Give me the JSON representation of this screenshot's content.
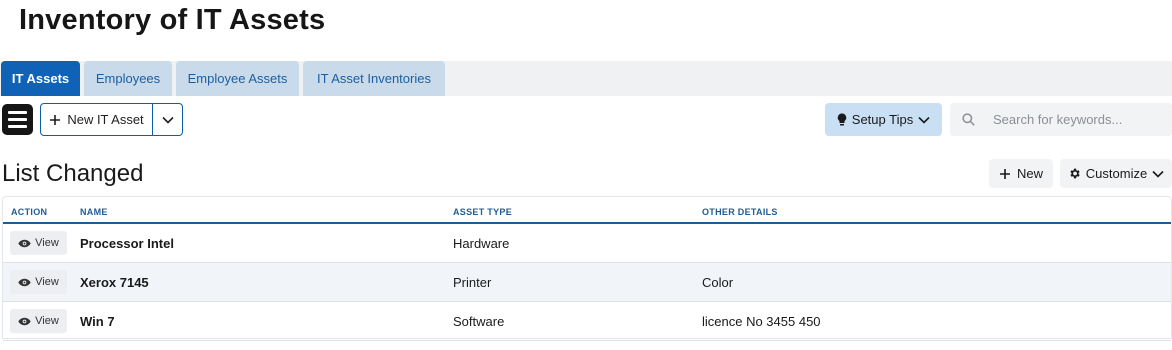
{
  "page": {
    "title": "Inventory of IT Assets"
  },
  "tabs": [
    {
      "label": "IT Assets",
      "active": true
    },
    {
      "label": "Employees",
      "active": false
    },
    {
      "label": "Employee Assets",
      "active": false
    },
    {
      "label": "IT Asset Inventories",
      "active": false
    }
  ],
  "toolbar": {
    "new_asset_label": "New IT Asset",
    "setup_tips_label": "Setup Tips",
    "search_placeholder": "Search for keywords..."
  },
  "list": {
    "title": "List Changed",
    "new_label": "New",
    "customize_label": "Customize",
    "columns": [
      "ACTION",
      "NAME",
      "ASSET TYPE",
      "OTHER DETAILS"
    ],
    "view_label": "View",
    "rows": [
      {
        "name": "Processor Intel",
        "asset_type": "Hardware",
        "other_details": ""
      },
      {
        "name": "Xerox 7145",
        "asset_type": "Printer",
        "other_details": "Color"
      },
      {
        "name": "Win 7",
        "asset_type": "Software",
        "other_details": "licence No 3455 450"
      }
    ]
  },
  "colors": {
    "accent": "#0f62b5",
    "tab_inactive": "#c9dbea",
    "header_text": "#1f5c96",
    "setup_tips_bg": "#c9dff3"
  },
  "icons": {
    "menu": "hamburger-icon",
    "plus": "plus-icon",
    "caret": "chevron-down-icon",
    "tips": "lightbulb-icon",
    "search": "search-icon",
    "customize": "gear-icon",
    "view": "eye-icon"
  }
}
